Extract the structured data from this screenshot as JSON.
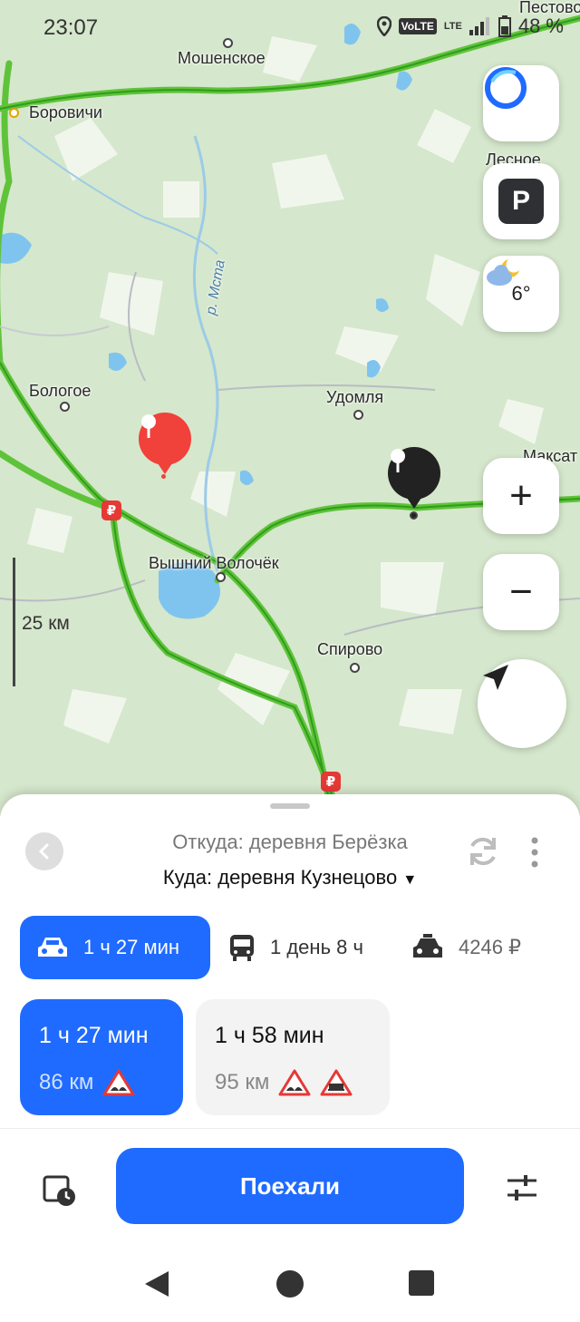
{
  "status_bar": {
    "time": "23:07",
    "volte": "VoLTE",
    "lte": "LTE",
    "battery": "48 %"
  },
  "map": {
    "cities": [
      "Мошенское",
      "Боровичи",
      "Бологое",
      "Удомля",
      "Вышний Волочёк",
      "Спирово",
      "Лесное",
      "Пестово",
      "Максат"
    ],
    "river": "р. Мста",
    "scale": "25 км",
    "weather_temp": "6°",
    "ruble": "₽",
    "parking": "P",
    "zoom_in": "+",
    "zoom_out": "−"
  },
  "route": {
    "from": "Откуда: деревня Берёзка",
    "to": "Куда: деревня Кузнецово",
    "to_caret": "▼",
    "modes": [
      {
        "label": "1 ч 27 мин",
        "icon": "car-icon"
      },
      {
        "label": "1 день 8 ч",
        "icon": "bus-icon"
      },
      {
        "label": "4246 ₽",
        "icon": "taxi-icon"
      }
    ],
    "options": [
      {
        "time": "1 ч 27 мин",
        "distance": "86 км"
      },
      {
        "time": "1 ч 58 мин",
        "distance": "95 км"
      }
    ],
    "go_label": "Поехали"
  },
  "colors": {
    "accent": "#1f6bff",
    "road": "#5fc33a",
    "pin_red": "#f0413a",
    "water": "#7fc4ef"
  }
}
